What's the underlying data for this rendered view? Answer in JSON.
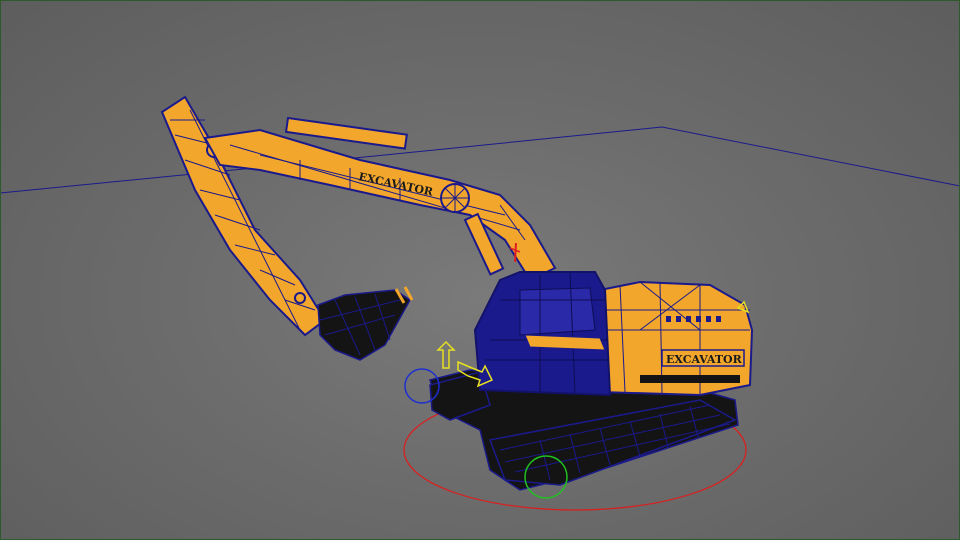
{
  "scene": {
    "background_color": "#6b6b6b",
    "ground_grid_color": "#1f1f9a",
    "wireframe_color": "#1b1a8c",
    "body_color": "#f2a62c",
    "track_color": "#141414"
  },
  "model": {
    "boom_label": "EXCAVATOR",
    "cab_label": "EXCAVATOR"
  },
  "gizmos": {
    "rotate_ring_color": "#d92020",
    "pivot_ring_color": "#1e2fd0",
    "green_ring_color": "#20c020",
    "move_arrow_color": "#e6e020",
    "axis_color": "#e02020"
  }
}
